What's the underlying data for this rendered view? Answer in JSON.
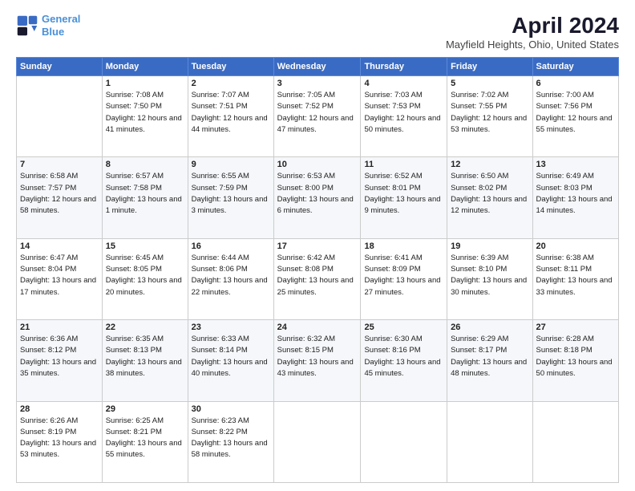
{
  "logo": {
    "line1": "General",
    "line2": "Blue"
  },
  "title": "April 2024",
  "subtitle": "Mayfield Heights, Ohio, United States",
  "header": {
    "days": [
      "Sunday",
      "Monday",
      "Tuesday",
      "Wednesday",
      "Thursday",
      "Friday",
      "Saturday"
    ]
  },
  "weeks": [
    [
      {
        "day": "",
        "sunrise": "",
        "sunset": "",
        "daylight": ""
      },
      {
        "day": "1",
        "sunrise": "Sunrise: 7:08 AM",
        "sunset": "Sunset: 7:50 PM",
        "daylight": "Daylight: 12 hours and 41 minutes."
      },
      {
        "day": "2",
        "sunrise": "Sunrise: 7:07 AM",
        "sunset": "Sunset: 7:51 PM",
        "daylight": "Daylight: 12 hours and 44 minutes."
      },
      {
        "day": "3",
        "sunrise": "Sunrise: 7:05 AM",
        "sunset": "Sunset: 7:52 PM",
        "daylight": "Daylight: 12 hours and 47 minutes."
      },
      {
        "day": "4",
        "sunrise": "Sunrise: 7:03 AM",
        "sunset": "Sunset: 7:53 PM",
        "daylight": "Daylight: 12 hours and 50 minutes."
      },
      {
        "day": "5",
        "sunrise": "Sunrise: 7:02 AM",
        "sunset": "Sunset: 7:55 PM",
        "daylight": "Daylight: 12 hours and 53 minutes."
      },
      {
        "day": "6",
        "sunrise": "Sunrise: 7:00 AM",
        "sunset": "Sunset: 7:56 PM",
        "daylight": "Daylight: 12 hours and 55 minutes."
      }
    ],
    [
      {
        "day": "7",
        "sunrise": "Sunrise: 6:58 AM",
        "sunset": "Sunset: 7:57 PM",
        "daylight": "Daylight: 12 hours and 58 minutes."
      },
      {
        "day": "8",
        "sunrise": "Sunrise: 6:57 AM",
        "sunset": "Sunset: 7:58 PM",
        "daylight": "Daylight: 13 hours and 1 minute."
      },
      {
        "day": "9",
        "sunrise": "Sunrise: 6:55 AM",
        "sunset": "Sunset: 7:59 PM",
        "daylight": "Daylight: 13 hours and 3 minutes."
      },
      {
        "day": "10",
        "sunrise": "Sunrise: 6:53 AM",
        "sunset": "Sunset: 8:00 PM",
        "daylight": "Daylight: 13 hours and 6 minutes."
      },
      {
        "day": "11",
        "sunrise": "Sunrise: 6:52 AM",
        "sunset": "Sunset: 8:01 PM",
        "daylight": "Daylight: 13 hours and 9 minutes."
      },
      {
        "day": "12",
        "sunrise": "Sunrise: 6:50 AM",
        "sunset": "Sunset: 8:02 PM",
        "daylight": "Daylight: 13 hours and 12 minutes."
      },
      {
        "day": "13",
        "sunrise": "Sunrise: 6:49 AM",
        "sunset": "Sunset: 8:03 PM",
        "daylight": "Daylight: 13 hours and 14 minutes."
      }
    ],
    [
      {
        "day": "14",
        "sunrise": "Sunrise: 6:47 AM",
        "sunset": "Sunset: 8:04 PM",
        "daylight": "Daylight: 13 hours and 17 minutes."
      },
      {
        "day": "15",
        "sunrise": "Sunrise: 6:45 AM",
        "sunset": "Sunset: 8:05 PM",
        "daylight": "Daylight: 13 hours and 20 minutes."
      },
      {
        "day": "16",
        "sunrise": "Sunrise: 6:44 AM",
        "sunset": "Sunset: 8:06 PM",
        "daylight": "Daylight: 13 hours and 22 minutes."
      },
      {
        "day": "17",
        "sunrise": "Sunrise: 6:42 AM",
        "sunset": "Sunset: 8:08 PM",
        "daylight": "Daylight: 13 hours and 25 minutes."
      },
      {
        "day": "18",
        "sunrise": "Sunrise: 6:41 AM",
        "sunset": "Sunset: 8:09 PM",
        "daylight": "Daylight: 13 hours and 27 minutes."
      },
      {
        "day": "19",
        "sunrise": "Sunrise: 6:39 AM",
        "sunset": "Sunset: 8:10 PM",
        "daylight": "Daylight: 13 hours and 30 minutes."
      },
      {
        "day": "20",
        "sunrise": "Sunrise: 6:38 AM",
        "sunset": "Sunset: 8:11 PM",
        "daylight": "Daylight: 13 hours and 33 minutes."
      }
    ],
    [
      {
        "day": "21",
        "sunrise": "Sunrise: 6:36 AM",
        "sunset": "Sunset: 8:12 PM",
        "daylight": "Daylight: 13 hours and 35 minutes."
      },
      {
        "day": "22",
        "sunrise": "Sunrise: 6:35 AM",
        "sunset": "Sunset: 8:13 PM",
        "daylight": "Daylight: 13 hours and 38 minutes."
      },
      {
        "day": "23",
        "sunrise": "Sunrise: 6:33 AM",
        "sunset": "Sunset: 8:14 PM",
        "daylight": "Daylight: 13 hours and 40 minutes."
      },
      {
        "day": "24",
        "sunrise": "Sunrise: 6:32 AM",
        "sunset": "Sunset: 8:15 PM",
        "daylight": "Daylight: 13 hours and 43 minutes."
      },
      {
        "day": "25",
        "sunrise": "Sunrise: 6:30 AM",
        "sunset": "Sunset: 8:16 PM",
        "daylight": "Daylight: 13 hours and 45 minutes."
      },
      {
        "day": "26",
        "sunrise": "Sunrise: 6:29 AM",
        "sunset": "Sunset: 8:17 PM",
        "daylight": "Daylight: 13 hours and 48 minutes."
      },
      {
        "day": "27",
        "sunrise": "Sunrise: 6:28 AM",
        "sunset": "Sunset: 8:18 PM",
        "daylight": "Daylight: 13 hours and 50 minutes."
      }
    ],
    [
      {
        "day": "28",
        "sunrise": "Sunrise: 6:26 AM",
        "sunset": "Sunset: 8:19 PM",
        "daylight": "Daylight: 13 hours and 53 minutes."
      },
      {
        "day": "29",
        "sunrise": "Sunrise: 6:25 AM",
        "sunset": "Sunset: 8:21 PM",
        "daylight": "Daylight: 13 hours and 55 minutes."
      },
      {
        "day": "30",
        "sunrise": "Sunrise: 6:23 AM",
        "sunset": "Sunset: 8:22 PM",
        "daylight": "Daylight: 13 hours and 58 minutes."
      },
      {
        "day": "",
        "sunrise": "",
        "sunset": "",
        "daylight": ""
      },
      {
        "day": "",
        "sunrise": "",
        "sunset": "",
        "daylight": ""
      },
      {
        "day": "",
        "sunrise": "",
        "sunset": "",
        "daylight": ""
      },
      {
        "day": "",
        "sunrise": "",
        "sunset": "",
        "daylight": ""
      }
    ]
  ]
}
